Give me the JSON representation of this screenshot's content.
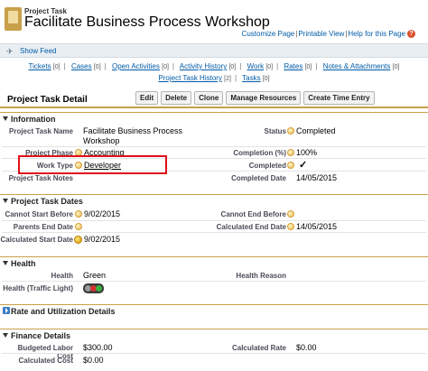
{
  "header": {
    "object_type": "Project Task",
    "title": "Facilitate Business Process Workshop",
    "links": [
      "Customize Page",
      "Printable View",
      "Help for this Page"
    ],
    "help_icon": "question-icon"
  },
  "feed": {
    "label": "Show Feed",
    "icon": "feed-icon"
  },
  "related_links": {
    "row1": [
      {
        "label": "Tickets",
        "count": "[0]"
      },
      {
        "label": "Cases",
        "count": "[0]"
      },
      {
        "label": "Open Activities",
        "count": "[0]"
      },
      {
        "label": "Activity History",
        "count": "[0]"
      },
      {
        "label": "Work",
        "count": "[0]"
      },
      {
        "label": "Rates",
        "count": "[0]"
      },
      {
        "label": "Notes & Attachments",
        "count": "[0]"
      }
    ],
    "row2": [
      {
        "label": "Project Task History",
        "count": "[2]"
      },
      {
        "label": "Tasks",
        "count": "[0]"
      }
    ]
  },
  "detail": {
    "title": "Project Task Detail",
    "buttons": [
      "Edit",
      "Delete",
      "Clone",
      "Manage Resources",
      "Create Time Entry"
    ]
  },
  "information": {
    "title": "Information",
    "project_task_name_label": "Project Task Name",
    "project_task_name_value1": "Facilitate Business Process",
    "project_task_name_value2": "Workshop",
    "status_label": "Status",
    "status_value": "Completed",
    "project_phase_label": "Project Phase",
    "project_phase_value": "Accounting",
    "completion_label": "Completion (%)",
    "completion_value": "100%",
    "work_type_label": "Work Type",
    "work_type_value": "Developer",
    "completed_label": "Completed",
    "completed_value": "✓",
    "project_task_notes_label": "Project Task Notes",
    "completed_date_label": "Completed Date",
    "completed_date_value": "14/05/2015"
  },
  "dates": {
    "title": "Project Task Dates",
    "cannot_start_before_label": "Cannot Start Before",
    "cannot_start_before_value": "9/02/2015",
    "cannot_end_before_label": "Cannot End Before",
    "parents_end_date_label": "Parents End Date",
    "calculated_end_date_label": "Calculated End Date",
    "calculated_end_date_value": "14/05/2015",
    "calculated_start_date_label": "Calculated Start Date",
    "calculated_start_date_value": "9/02/2015"
  },
  "health": {
    "title": "Health",
    "health_label": "Health",
    "health_value": "Green",
    "health_reason_label": "Health Reason",
    "traffic_light_label": "Health (Traffic Light)",
    "light_colors": [
      "#9a9a9a",
      "#d33030",
      "#38b040"
    ]
  },
  "rate": {
    "title": "Rate and Utilization Details"
  },
  "finance": {
    "title": "Finance Details",
    "budgeted_labor_cost_label": "Budgeted Labor Cost",
    "budgeted_labor_cost_value": "$300.00",
    "calculated_rate_label": "Calculated Rate",
    "calculated_rate_value": "$0.00",
    "calculated_cost_label": "Calculated Cost",
    "calculated_cost_value": "$0.00"
  },
  "colors": {
    "accent": "#c8a04a",
    "link": "#015ba7",
    "highlight_box": "#e0101a"
  }
}
